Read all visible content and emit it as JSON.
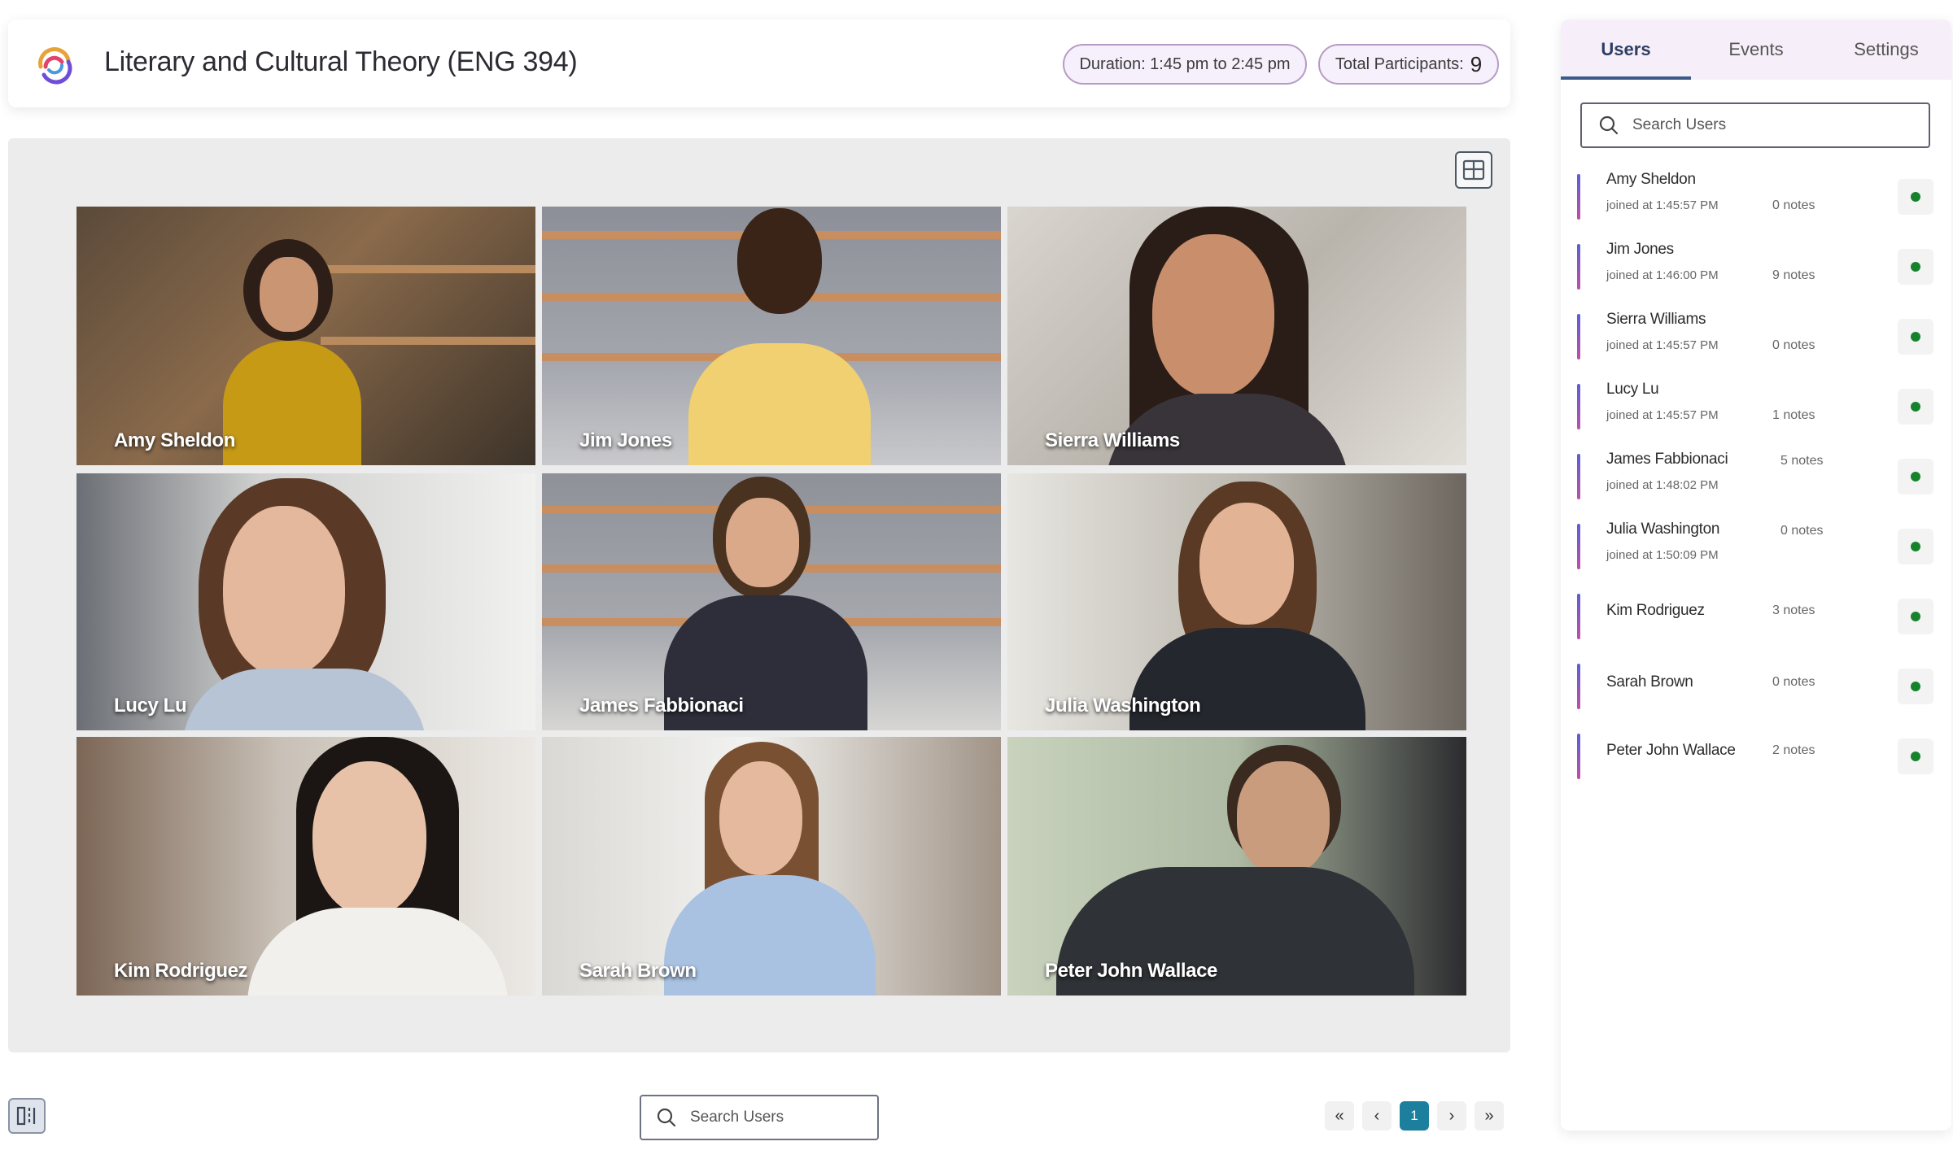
{
  "header": {
    "title": "Literary and Cultural Theory (ENG 394)",
    "duration": "Duration: 1:45 pm to 2:45 pm",
    "participants_label": "Total Participants:",
    "participants_count": "9"
  },
  "tiles": [
    {
      "name": "Amy Sheldon"
    },
    {
      "name": "Jim Jones"
    },
    {
      "name": "Sierra Williams"
    },
    {
      "name": "Lucy Lu"
    },
    {
      "name": "James Fabbionaci"
    },
    {
      "name": "Julia Washington"
    },
    {
      "name": "Kim Rodriguez"
    },
    {
      "name": "Sarah Brown"
    },
    {
      "name": "Peter John Wallace"
    }
  ],
  "bottom": {
    "search_placeholder": "Search Users",
    "pager": {
      "first": "«",
      "prev": "‹",
      "current": "1",
      "next": "›",
      "last": "»"
    }
  },
  "panel": {
    "tabs": [
      {
        "label": "Users",
        "active": true
      },
      {
        "label": "Events",
        "active": false
      },
      {
        "label": "Settings",
        "active": false
      }
    ],
    "search_placeholder": "Search Users",
    "users": [
      {
        "name": "Amy Sheldon",
        "joined": "joined at 1:45:57 PM",
        "notes": "0 notes",
        "online": true
      },
      {
        "name": "Jim Jones",
        "joined": "joined at 1:46:00 PM",
        "notes": "9 notes",
        "online": true
      },
      {
        "name": "Sierra Williams",
        "joined": "joined at 1:45:57 PM",
        "notes": "0 notes",
        "online": true
      },
      {
        "name": "Lucy Lu",
        "joined": "joined at 1:45:57 PM",
        "notes": "1 notes",
        "online": true
      },
      {
        "name": "James Fabbionaci",
        "joined": "joined at 1:48:02 PM",
        "notes": "5 notes",
        "online": true
      },
      {
        "name": "Julia Washington",
        "joined": "joined at 1:50:09 PM",
        "notes": "0 notes",
        "online": true
      },
      {
        "name": "Kim Rodriguez",
        "joined": "",
        "notes": "3 notes",
        "online": true
      },
      {
        "name": "Sarah Brown",
        "joined": "",
        "notes": "0 notes",
        "online": true
      },
      {
        "name": "Peter John Wallace",
        "joined": "",
        "notes": "2 notes",
        "online": true
      }
    ]
  },
  "colors": {
    "accent": "#1d7f9e",
    "online": "#15832b",
    "tab_active": "#2e3e62",
    "pill_border": "#b79bc4"
  }
}
